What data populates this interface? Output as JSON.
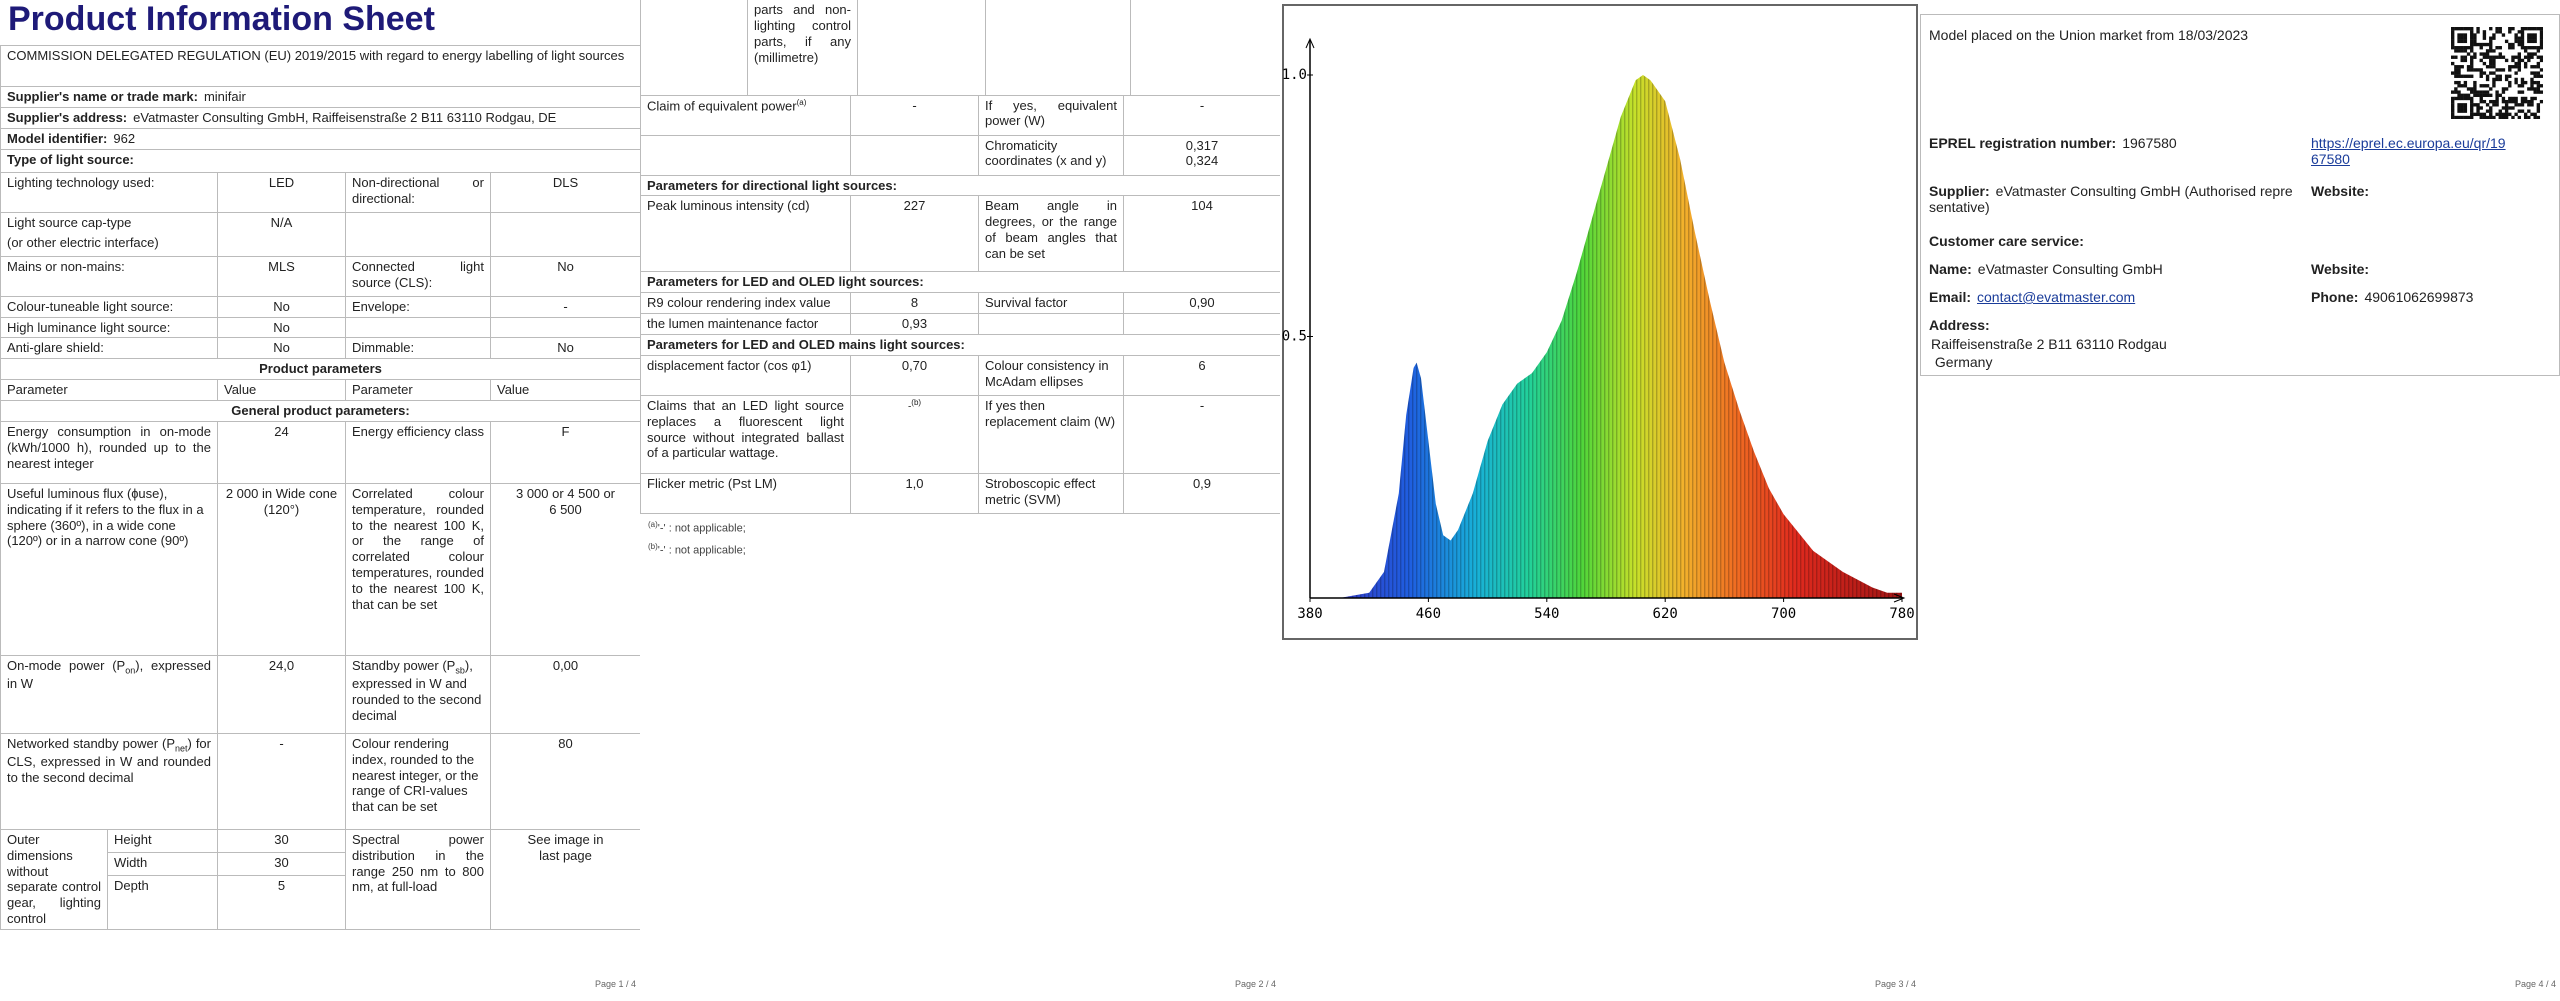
{
  "page1": {
    "title": "Product Information Sheet",
    "regulation": "COMMISSION DELEGATED REGULATION (EU) 2019/2015 with regard to energy labelling of light sources",
    "supplier_name_label": "Supplier's name or trade mark:",
    "supplier_name": "minifair",
    "supplier_address_label": "Supplier's address:",
    "supplier_address": "eVatmaster Consulting GmbH, Raiffeisenstraße 2 B11 63110 Rodgau, DE",
    "model_label": "Model identifier:",
    "model": "962",
    "type_heading": "Type of light source:",
    "rows": {
      "lighting_tech": {
        "label": "Lighting technology used:",
        "value": "LED"
      },
      "directional": {
        "label": "Non-directional or directional:",
        "value": "DLS"
      },
      "cap_type": {
        "label": "Light source cap-type",
        "label2": "(or other electric interface)",
        "value": "N/A"
      },
      "mains": {
        "label": "Mains or non-mains:",
        "value": "MLS"
      },
      "cls": {
        "label": "Connected light source (CLS):",
        "value": "No"
      },
      "tuneable": {
        "label": "Colour-tuneable light source:",
        "value": "No"
      },
      "envelope": {
        "label": "Envelope:",
        "value": "-"
      },
      "high_lum": {
        "label": "High luminance light source:",
        "value": "No"
      },
      "antiglare": {
        "label": "Anti-glare shield:",
        "value": "No"
      },
      "dimmable": {
        "label": "Dimmable:",
        "value": "No"
      }
    },
    "product_params": "Product parameters",
    "col_param": "Parameter",
    "col_value": "Value",
    "general_params": "General product parameters:",
    "energy": {
      "label": "Energy consumption in on-mode (kWh/1000 h), rounded up to the nearest integer",
      "value": "24"
    },
    "eff_class": {
      "label": "Energy efficiency class",
      "value": "F"
    },
    "flux": {
      "label": "Useful luminous flux (ɸuse), indicating if it refers to the flux in a sphere (360º), in a wide cone (120º) or in a narrow cone (90º)",
      "value": "2 000 in Wide cone (120°)"
    },
    "cct": {
      "label": "Correlated colour temperature, rounded to the nearest 100 K, or the range of correlated colour temperatures, rounded to the nearest 100 K, that can be set",
      "value": "3 000 or 4 500 or 6 500"
    },
    "onmode": {
      "label_a": "On-mode power (P",
      "sub": "on",
      "label_b": "), expressed in W",
      "value": "24,0"
    },
    "standby": {
      "label_a": "Standby power (P",
      "sub": "sb",
      "label_b": "), expressed in W and rounded to the second decimal",
      "value": "0,00"
    },
    "networked": {
      "label_a": "Networked standby power (P",
      "sub": "net",
      "label_b": ") for CLS, expressed in W and rounded to the second decimal",
      "value": "-"
    },
    "cri": {
      "label": "Colour rendering index, rounded to the nearest integer, or the range of CRI-values that can be set",
      "value": "80"
    },
    "outer": {
      "label": "Outer dimensions without separate control gear, lighting control",
      "height_label": "Height",
      "height": "30",
      "width_label": "Width",
      "width": "30",
      "depth_label": "Depth",
      "depth": "5"
    },
    "spectral": {
      "label": "Spectral power distribution in the range 250 nm to 800 nm, at full-load",
      "value": "See image in last page"
    },
    "page_no": "Page 1 / 4"
  },
  "page2": {
    "cont_label": "parts and non-lighting control parts, if any (millimetre)",
    "claim_equiv": {
      "label": "Claim of equivalent power",
      "sup": "(a)",
      "value": "-"
    },
    "equiv_power": {
      "label": "If yes, equivalent power (W)",
      "value": "-"
    },
    "chroma": {
      "label": "Chromaticity coordinates (x and y)",
      "x": "0,317",
      "y": "0,324"
    },
    "directional_heading": "Parameters for directional light sources:",
    "peak": {
      "label": "Peak luminous intensity (cd)",
      "value": "227"
    },
    "beam": {
      "label": "Beam angle in degrees, or the range of beam angles that can be set",
      "value": "104"
    },
    "led_heading": "Parameters for LED and OLED light sources:",
    "r9": {
      "label": "R9 colour rendering index value",
      "value": "8"
    },
    "survival": {
      "label": "Survival factor",
      "value": "0,90"
    },
    "lumen_maint": {
      "label": "the lumen maintenance factor",
      "value": "0,93"
    },
    "mains_heading": "Parameters for LED and OLED mains light sources:",
    "displacement": {
      "label": "displacement factor (cos φ1)",
      "value": "0,70"
    },
    "consistency": {
      "label": "Colour consistency in McAdam ellipses",
      "value": "6"
    },
    "claims_led": {
      "label": "Claims that an LED light source replaces a fluorescent light source without integrated ballast of a particular wattage.",
      "value": "-",
      "sup": "(b)"
    },
    "replacement": {
      "label": "If yes then replacement claim (W)",
      "value": "-"
    },
    "flicker": {
      "label": "Flicker metric (Pst LM)",
      "value": "1,0"
    },
    "strobo": {
      "label": "Stroboscopic effect metric (SVM)",
      "value": "0,9"
    },
    "note_a_sup": "(a)",
    "note_a": "'-' : not applicable;",
    "note_b_sup": "(b)",
    "note_b": "'-' : not applicable;",
    "page_no": "Page 2 / 4"
  },
  "page3": {
    "page_no": "Page 3 / 4",
    "chart_data": {
      "type": "area",
      "title": "",
      "xlabel": "",
      "ylabel": "",
      "xlim": [
        380,
        780
      ],
      "ylim": [
        0,
        1.0
      ],
      "xticks": [
        "380",
        "460",
        "540",
        "620",
        "700",
        "780"
      ],
      "yticks": [
        "0.5",
        "1.0"
      ],
      "grid": false,
      "series": [
        {
          "x": [
            380,
            400,
            420,
            430,
            440,
            445,
            450,
            452,
            455,
            460,
            465,
            470,
            475,
            480,
            490,
            500,
            510,
            520,
            530,
            540,
            550,
            560,
            570,
            580,
            590,
            600,
            605,
            610,
            620,
            630,
            640,
            650,
            660,
            670,
            680,
            690,
            700,
            720,
            740,
            760,
            770,
            780
          ],
          "y": [
            0,
            0,
            0.01,
            0.05,
            0.2,
            0.35,
            0.44,
            0.45,
            0.42,
            0.3,
            0.18,
            0.12,
            0.11,
            0.13,
            0.2,
            0.3,
            0.37,
            0.41,
            0.43,
            0.47,
            0.53,
            0.62,
            0.72,
            0.82,
            0.92,
            0.99,
            1.0,
            0.99,
            0.95,
            0.84,
            0.7,
            0.57,
            0.45,
            0.36,
            0.28,
            0.21,
            0.16,
            0.09,
            0.05,
            0.02,
            0.01,
            0.01
          ]
        }
      ]
    }
  },
  "page4": {
    "placed": "Model placed on the Union market from 18/03/2023",
    "eprel_label": "EPREL registration number:",
    "eprel": "1967580",
    "eprel_link_1": "https://eprel.ec.europa.eu/qr/19",
    "eprel_link_2": "67580",
    "supplier_label": "Supplier:",
    "supplier_1": "eVatmaster Consulting GmbH (Authorised repre",
    "supplier_2": "sentative)",
    "website_label": "Website:",
    "care_heading": "Customer care service:",
    "name_label": "Name:",
    "name": "eVatmaster Consulting GmbH",
    "website2_label": "Website:",
    "email_label": "Email:",
    "email": "contact@evatmaster.com",
    "phone_label": "Phone:",
    "phone": "49061062699873",
    "address_label": "Address:",
    "address_1": "Raiffeisenstraße 2 B11 63110 Rodgau",
    "address_2": "Germany",
    "page_no": "Page 4 / 4"
  }
}
